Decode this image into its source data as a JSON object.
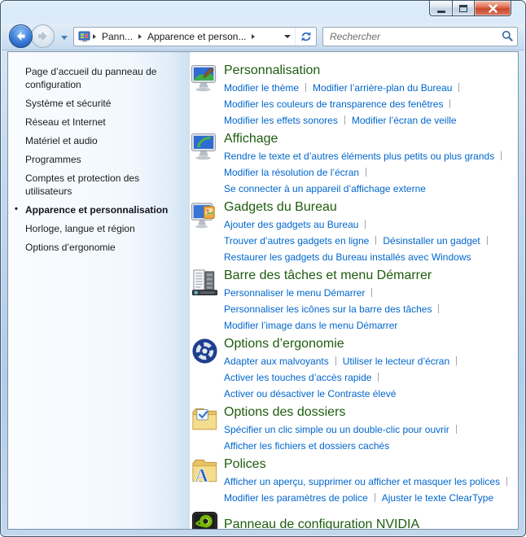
{
  "toolbar": {
    "breadcrumb": [
      "Pann...",
      "Apparence et person..."
    ],
    "search_placeholder": "Rechercher"
  },
  "sidebar": {
    "active_bullet": "•",
    "items": [
      {
        "label": "Page d’accueil du panneau de configuration",
        "active": false
      },
      {
        "label": "Système et sécurité",
        "active": false
      },
      {
        "label": "Réseau et Internet",
        "active": false
      },
      {
        "label": "Matériel et audio",
        "active": false
      },
      {
        "label": "Programmes",
        "active": false
      },
      {
        "label": "Comptes et protection des utilisateurs",
        "active": false
      },
      {
        "label": "Apparence et personnalisation",
        "active": true
      },
      {
        "label": "Horloge, langue et région",
        "active": false
      },
      {
        "label": "Options d’ergonomie",
        "active": false
      }
    ]
  },
  "main": {
    "sections": [
      {
        "title": "Personnalisation",
        "icon": "personalization",
        "link_lines": [
          [
            "Modifier le thème",
            "Modifier l’arrière-plan du Bureau"
          ],
          [
            "Modifier les couleurs de transparence des fenêtres"
          ],
          [
            "Modifier les effets sonores",
            "Modifier l’écran de veille"
          ]
        ]
      },
      {
        "title": "Affichage",
        "icon": "display",
        "link_lines": [
          [
            "Rendre le texte et d’autres éléments plus petits ou plus grands"
          ],
          [
            "Modifier la résolution de l’écran"
          ],
          [
            "Se connecter à un appareil d’affichage externe"
          ]
        ]
      },
      {
        "title": "Gadgets du Bureau",
        "icon": "desktop-gadgets",
        "link_lines": [
          [
            "Ajouter des gadgets au Bureau"
          ],
          [
            "Trouver d’autres gadgets en ligne",
            "Désinstaller un gadget"
          ],
          [
            "Restaurer les gadgets du Bureau installés avec Windows"
          ]
        ]
      },
      {
        "title": "Barre des tâches et menu Démarrer",
        "icon": "taskbar-start-menu",
        "link_lines": [
          [
            "Personnaliser le menu Démarrer"
          ],
          [
            "Personnaliser les icônes sur la barre des tâches"
          ],
          [
            "Modifier l’image dans le menu Démarrer"
          ]
        ]
      },
      {
        "title": "Options d’ergonomie",
        "icon": "ease-of-access",
        "link_lines": [
          [
            "Adapter aux malvoyants",
            "Utiliser le lecteur d’écran"
          ],
          [
            "Activer les touches d’accès rapide"
          ],
          [
            "Activer ou désactiver le Contraste élevé"
          ]
        ]
      },
      {
        "title": "Options des dossiers",
        "icon": "folder-options",
        "link_lines": [
          [
            "Spécifier un clic simple ou un double-clic pour ouvrir"
          ],
          [
            "Afficher les fichiers et dossiers cachés"
          ]
        ]
      },
      {
        "title": "Polices",
        "icon": "fonts",
        "link_lines": [
          [
            "Afficher un aperçu, supprimer ou afficher et masquer les polices"
          ],
          [
            "Modifier les paramètres de police",
            "Ajuster le texte ClearType"
          ]
        ]
      },
      {
        "title": "Panneau de configuration NVIDIA",
        "icon": "nvidia",
        "link_lines": []
      }
    ]
  },
  "colors": {
    "section_title": "#1e5c0e",
    "task_link": "#0066cc",
    "nvidia_green": "#76b900",
    "close_button_red": "#c94a2d"
  }
}
